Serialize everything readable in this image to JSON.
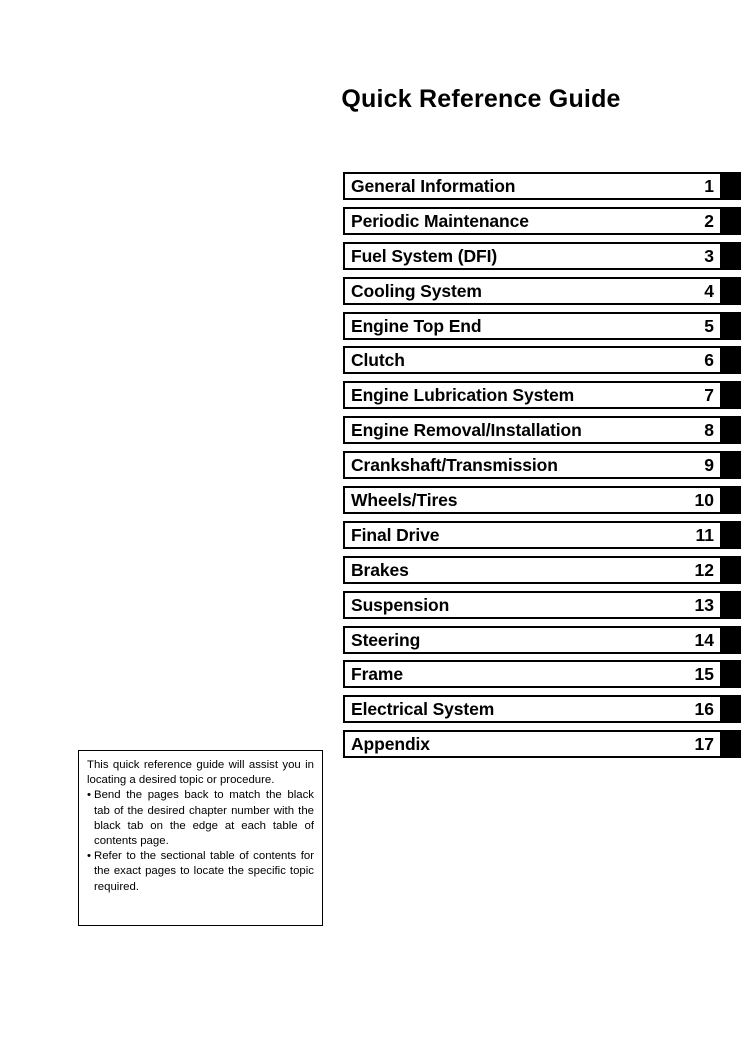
{
  "document": {
    "title": "Quick Reference Guide"
  },
  "chapter_index": [
    {
      "title": "General Information",
      "number": "1"
    },
    {
      "title": "Periodic Maintenance",
      "number": "2"
    },
    {
      "title": "Fuel System (DFI)",
      "number": "3"
    },
    {
      "title": "Cooling System",
      "number": "4"
    },
    {
      "title": "Engine Top End",
      "number": "5"
    },
    {
      "title": "Clutch",
      "number": "6"
    },
    {
      "title": "Engine Lubrication System",
      "number": "7"
    },
    {
      "title": "Engine Removal/Installation",
      "number": "8"
    },
    {
      "title": "Crankshaft/Transmission",
      "number": "9"
    },
    {
      "title": "Wheels/Tires",
      "number": "10"
    },
    {
      "title": "Final Drive",
      "number": "11"
    },
    {
      "title": "Brakes",
      "number": "12"
    },
    {
      "title": "Suspension",
      "number": "13"
    },
    {
      "title": "Steering",
      "number": "14"
    },
    {
      "title": "Frame",
      "number": "15"
    },
    {
      "title": "Electrical System",
      "number": "16"
    },
    {
      "title": "Appendix",
      "number": "17"
    }
  ],
  "note": {
    "intro": "This quick reference guide will assist you in locating a desired topic or procedure.",
    "bullet_mark": "•",
    "bullets": [
      "Bend the pages back to match the black tab of the desired chapter number with the black tab on the edge at each table of contents page.",
      "Refer to the sectional table of contents for the exact pages to locate the specific topic required."
    ]
  },
  "colors": {
    "ink": "#000000",
    "paper": "#ffffff",
    "tab": "#000000"
  }
}
